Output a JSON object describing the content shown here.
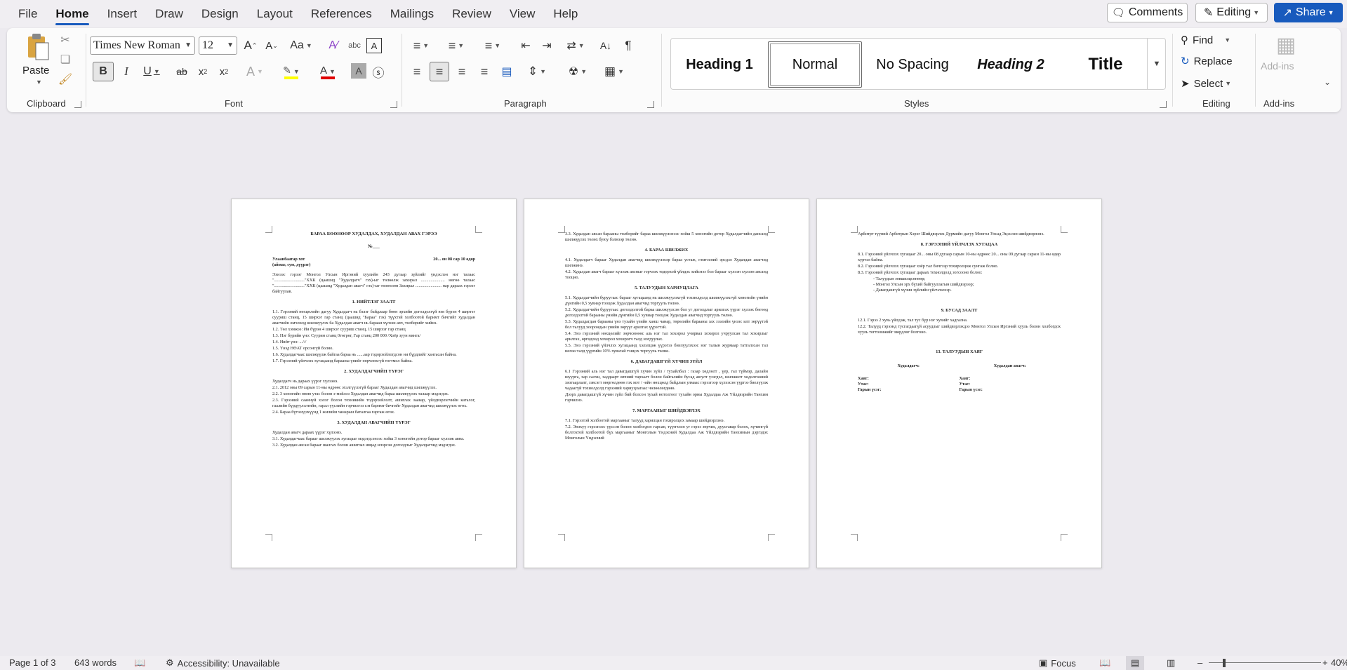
{
  "menu": {
    "tabs": [
      {
        "label": "File",
        "key": "file"
      },
      {
        "label": "Home",
        "key": "home"
      },
      {
        "label": "Insert",
        "key": "insert"
      },
      {
        "label": "Draw",
        "key": "draw"
      },
      {
        "label": "Design",
        "key": "design"
      },
      {
        "label": "Layout",
        "key": "layout"
      },
      {
        "label": "References",
        "key": "references"
      },
      {
        "label": "Mailings",
        "key": "mailings"
      },
      {
        "label": "Review",
        "key": "review"
      },
      {
        "label": "View",
        "key": "view"
      },
      {
        "label": "Help",
        "key": "help"
      }
    ],
    "active": "home",
    "comments_label": "Comments",
    "editing_label": "Editing",
    "share_label": "Share"
  },
  "ribbon": {
    "clipboard": {
      "paste_label": "Paste",
      "group_label": "Clipboard"
    },
    "font": {
      "name": "Times New Roman",
      "size": "12",
      "group_label": "Font",
      "highlight_color": "#ffff00",
      "font_color": "#e00000"
    },
    "paragraph": {
      "group_label": "Paragraph"
    },
    "styles": {
      "group_label": "Styles",
      "items": [
        "Heading 1",
        "Normal",
        "No Spacing",
        "Heading 2",
        "Title"
      ],
      "selected": "Normal"
    },
    "editing": {
      "group_label": "Editing",
      "find_label": "Find",
      "replace_label": "Replace",
      "select_label": "Select"
    },
    "addins": {
      "button_label": "Add-ins",
      "group_label": "Add-ins"
    }
  },
  "pages": {
    "p1": {
      "title": "БАРАА БӨӨНӨӨР ХУДАЛДАХ, ХУДАЛДАН АВАХ ГЭРЭЭ",
      "number": "№___",
      "city": "Улаанбаатар хот",
      "city_sub": "(аймаг, сум, дүүрэг)",
      "date": "20... он 08 сар 10 өдөр",
      "intro": "Эхнээс гэрээг Монгол Улсын Иргэний хуулийн 243 дугаар зүйлийг үндэслэн нэг талаас \"............................\"ХХК (цаашид \"Худалдагч\" гэх)-ыг төлөөлж захирал ...................... нөгөө талаас \"............................\"ХХК (цаашид \"Худалдан авагч\" гэх)-ыг төлөөлөн Захирал ........................ нар дараах гэрээг байгуулав.",
      "s1_title": "1. НИЙТЛЭГ ЗААЛТ",
      "s1_1": "1.1. Гэрээний нөхцөлийн дагуу Худалдагч нь бэлэг байдлаар бөөн эрхийн доголдолгүй юм бүрэн 4 ширтэг сууриш станц, 15 ширхэг гар станц (цаашид \"Бараа\" гэх) түүхтэй холбоотой баримт бичгийг худалдан авагчийн өмчлөлд шилжүүлэх ба Худалдан авагч нь бараан хүлээн авч, төлбөрийг хийнэ.",
      "s1_2": "1.2. Төл хэмжээ: Ии бүрэн 4 ширхэг сууриш станц, 15 ширхэг гар станц",
      "s1_3": "1.3. Нэг бүрийн үнэ: Суурин станц 0төгрөг, Гар станц 200 000 /Хоёр зуун мянга/",
      "s1_4": "1.4. Нийт үнэ: ...///",
      "s1_5": "1.5. Үнэд НӨАТ орсонгүй болно.",
      "s1_6": "1.6. Худалдагчаас шилжүүлж байгаа бараа нь ......аар тодорхойлогдсон ни бүрдлийг хангасан байна.",
      "s1_7": "1.7. Гэрээний үйлчлэх хугацаанд барааны үнийг өөрчлөхгүй тогтмол байна.",
      "s2_title": "2. ХУДАЛДАГЧИЙН ҮҮРЭГ",
      "s2_0": "Худалдагч нь дараах үүрэг хүлээнэ.",
      "s2_1": "2.1. 2012 оны 09 сарын 11-ны өдрөөс эхэлгүүлэгүй барааг Худалдан авагчид шилжүүлэх.",
      "s2_2": "2.2. 3 хоногийн өмнө утас болон э-мэйлээ Худалдан авагчид бараа шилжүүлэх талаар мэдэгдэх.",
      "s2_3": "2.3. Гэрээний сааннуй хэлэг болон техникийн тодорхойлолт, ашиглах заавар, үйлдвэрлэгчийн каталог, гаалийн бүрдүүлэлтийн, гарал үүслийн гэрчилгээ г.м баримт бичгийг Худалдан авагчид шилжүүлэх өгөх.",
      "s2_4": "2.4. Бараа бүтээгдэхүүнд 1 жилийн чанарын баталгаа гаргаж өгөх.",
      "s3_title": "3. ХУДАЛДАН АВАГЧИЙН ҮҮРЭГ",
      "s3_0": "Худалдан авагч дараах үүрэг хүлээнэ.",
      "s3_1": "3.1. Худалдагчаас барааг шилжүүлэх хугацааг мэдэгдсэнээс хойш 3 хоногийн дотор барааг хүлээж авна.",
      "s3_2": "3.2. Худалдан авсан барааг шалгах болон ашиглах явцад илэрсэн доголдлыг Худалдагчид мэдэгдэх."
    },
    "p2": {
      "s3_3": "3.3. Худалдан авсан барааны төлбөрийг бараа шилжүүлснээс хойш 5 хоногийн дотор Худалдагчийн дансанд шилжүүлэх төлөх буюу бэлнээр төлнө.",
      "s4_title": "4. БАРАА ШИЛЖИХ",
      "s4_1": "4.1. Худалдагч барааг Худалдан авагчид шилжүүлэхэр бараа устаж, гэмтэсний эрсдэл Худалдан авагчид шилжинэ.",
      "s4_2": "4.2. Худалдан авагч барааг хүлээж авсныг гэрчлэх тодорхой үйлдэх хийснээ бол барааг хүлээн хүлээн авсанд тооцно.",
      "s5_title": "5. ТАЛУУДЫН ХАРИУЦЛАГА",
      "s5_1": "5.1. Худалдагчийн буруугаас барааг хугацаанд нь шилжүүлэхгүй тохиолдолд шилжүүлэхгүй хоногийн үнийн дүнгийн 0,5 хувиар тооцож Худалдан авагчид торгууль төлнө.",
      "s5_2": "5.2. Худалдагчийн буруугаас доголдолтой бараа шилжүүлсэн бол уг доголдлыг арилгах үүрэг хүлээх бөгөөд доголдолтой барааны үнийн дүнгийн 0,5 хувиар тооцож Худалдан авагчид торгууль төлнө.",
      "s5_3": "5.3. Худалдагдан барааны үнэ тухайн үеийн ханш чанар, төрөлийн барааны зах зээлийн үнээс илт зөрүүтэй бол талууд хоорондын үнийн зөрүүг арилгах үүрэгтэй.",
      "s5_4": "5.4. Энэ гэрээний нөхцөлийг зөрчсөнөөс аль нэг тал хохирол учирвал хохирол учруулсан тал хохирлыг арилгах, өргөдлөд хохирол хохирогч талд ногдуулах.",
      "s5_5": "5.5. Энэ гэрээний үйлчлэх хугацаанд хэлэлцэж үүрэгээ биелүүлэхээс нэг талын журмаар татгалзсан тал нөгөө талд үүргийн 10% хувьтай тэнцэх торгууль төлнө.",
      "s6_title": "6. ДАВАГДАШГҮЙ ХҮЧИН ЗҮЙЛ",
      "s6_1": "6.1 Гэрээний аль нэг тал давагдашгүй хүчин зүйл / тухайлбал : газар хөдлөлт , үер, гал түймэр, далайн шуурга, хар салхи, хаддаарт өвчний тархалт болон байгалийн бусад аюулт үзэгдэл, шилжилт хөдөлгөөний хязгаарлалт, зэвсэгт мөргөлдөөн гэх мэт / -ийн нөхцөлд байдлын улмаас гэрээгээр хүлээсэн үүргээ биелүүлж чадаагүй тохиолдолд гэрээний хариуцлагаас чөлөөлөгдөнө.",
      "s6_2": "Дээрх давагдашгүй хүчин зүйл бий болсон тухай нотолгоог тухайн орны Худалдаа Аж Үйлдвэрийн Танхим гэрчилнэ.",
      "s7_title": "7. МАРГААНЫГ ШИЙДВЭРЛЭХ",
      "s7_1": "7.1. Гэрээтэй холбоотой маргааныг талууд харилцан тохиролцох замаар шийдвэрлэнэ.",
      "s7_2": "7.2. Энэхүү гэрээнээс үүссэн болон холбогдон гарсан, түүнчлэн уг гэрээ зөрчих, дуусгавар болох, хүчингүй болгохтой холбоотой бүх маргааныг Монголын Үндэсний Худалдаа Аж Үйлдвэрийн Танхимын дэргэдэх Монголын Үндэсний"
    },
    "p3": {
      "cont": "Арбитрт түүний Арбитрын Хэрэг Шийдвэрлэх Дүрмийн дагуу Монгол Улсад Эцэслэн шийдвэрлэнэ.",
      "s8_title": "8. ГЭРЭЭНИЙ ҮЙЛЧЛЭХ ХУГАЦАА",
      "s8_1": "8.1. Гэрээний үйлчлэх хугацааг 20... оны 08 дугаар сарын 10-ны өдрөөс 20... оны 09 дугаар сарын 11-ны өдөр хүртэл байна.",
      "s8_2": "8.2. Гэрээний үйлчлэх хугацааг хоёр тал бичгээр тохиролцож сунгаж болно.",
      "s8_3": "8.3. Гэрээний үйлчлэх хугацааг дараах тохиолдолд зогсооно болно:",
      "s8_items": [
        "Талуудын зөвшилцсөнөөр;",
        "Монгол Улсын эрх бүхий байгууллагын шийдвэрээр;",
        "Давагдашгүй хүчин зүйлийн үйлчлэлээр."
      ],
      "s9_title": "9. БУСАД ЗААЛТ",
      "s9_1": "12.1. Гэрээ 2 хувь үйлдэж, тал тус бүр нэг хувийг хадгална.",
      "s9_2": "12.2. Талууд гэрээнд тусгагдаагүй асуудлыг шийдвэрлэхдээ Монгол Улсын Иргэний хууль болон холбогдох хууль тогтоомжийг мөрдлөг болгоно.",
      "s13_title": "13. ТАЛУУДЫН ХАЯГ",
      "seller": "Худалдагч:",
      "buyer": "Худалдан авагч:",
      "addr": "Хаяг:",
      "phone": "Утас:",
      "sign": "Гарын үсэг:"
    }
  },
  "status": {
    "page": "Page 1 of 3",
    "words": "643 words",
    "accessibility": "Accessibility: Unavailable",
    "focus": "Focus",
    "zoom": "40%"
  }
}
